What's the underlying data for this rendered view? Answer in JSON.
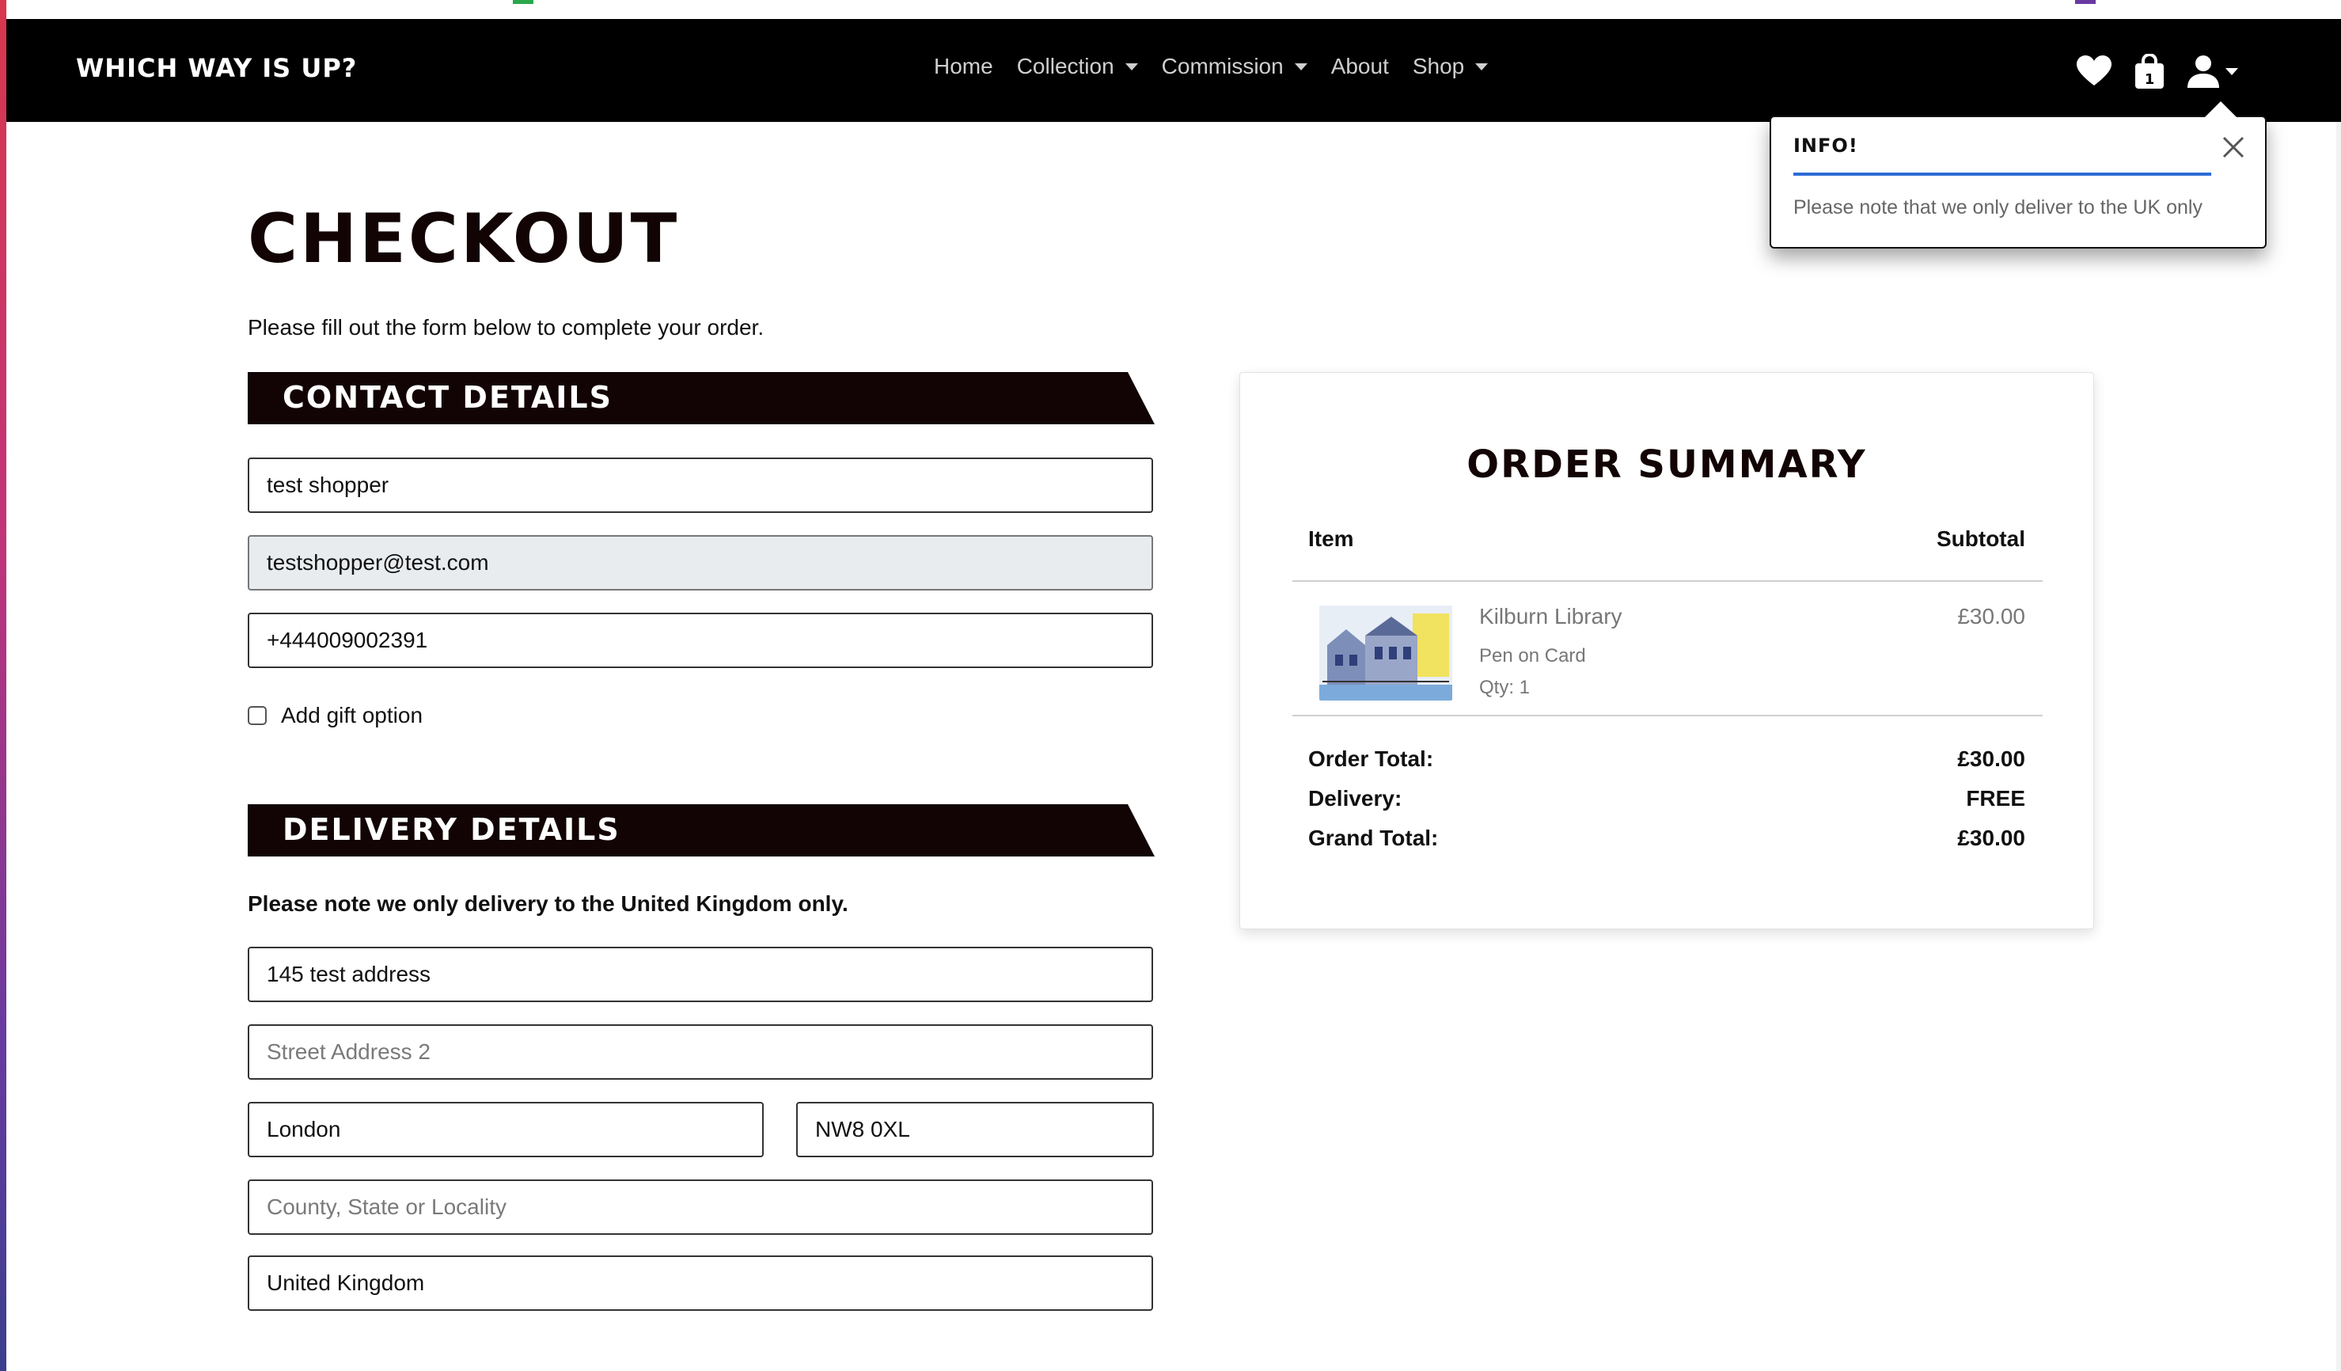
{
  "navbar": {
    "brand": "Which Way is Up?",
    "links": [
      {
        "label": "Home",
        "has_dropdown": false
      },
      {
        "label": "Collection",
        "has_dropdown": true
      },
      {
        "label": "Commission",
        "has_dropdown": true
      },
      {
        "label": "About",
        "has_dropdown": false
      },
      {
        "label": "Shop",
        "has_dropdown": true
      }
    ],
    "icons": [
      "heart-icon",
      "shopping-bag-icon",
      "user-icon"
    ],
    "bag_count": "1"
  },
  "toast": {
    "title": "Info!",
    "message": "Please note that we only deliver to the UK only",
    "accent_color": "#2c6cd6"
  },
  "checkout": {
    "title": "Checkout",
    "intro": "Please fill out the form below to complete your order.",
    "contact": {
      "heading": "Contact Details",
      "full_name": "test shopper",
      "email": "testshopper@test.com",
      "phone": "+444009002391",
      "gift_label": "Add gift option",
      "gift_checked": false
    },
    "delivery": {
      "heading": "Delivery Details",
      "note": "Please note we only delivery to the United Kingdom only.",
      "street1": "145 test address",
      "street2_placeholder": "Street Address 2",
      "town": "London",
      "postcode": "NW8 0XL",
      "county_placeholder": "County, State or Locality",
      "country": "United Kingdom"
    }
  },
  "summary": {
    "title": "Order Summary",
    "col_item": "Item",
    "col_subtotal": "Subtotal",
    "items": [
      {
        "name": "Kilburn Library",
        "medium": "Pen on Card",
        "qty": "Qty: 1",
        "price": "£30.00"
      }
    ],
    "order_total_label": "Order Total:",
    "order_total": "£30.00",
    "delivery_label": "Delivery:",
    "delivery": "FREE",
    "grand_total_label": "Grand Total:",
    "grand_total": "£30.00"
  },
  "colors": {
    "navbar_bg": "#000000",
    "banner_bg": "#120404",
    "title_color": "#120404"
  }
}
